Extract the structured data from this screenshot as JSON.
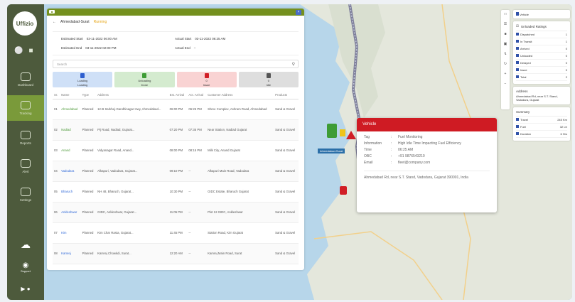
{
  "sidebar": {
    "logo": "Uffizio",
    "items": [
      {
        "label": "Dashboard",
        "icon": "gauge-icon"
      },
      {
        "label": "Tracking",
        "icon": "location-pin-icon",
        "active": true
      },
      {
        "label": "Reports",
        "icon": "report-icon"
      },
      {
        "label": "Alert",
        "icon": "bell-icon"
      },
      {
        "label": "Settings",
        "icon": "gear-icon"
      }
    ],
    "support": "Support"
  },
  "panel": {
    "breadcrumb": "Ahmedabad-Surat",
    "status": "Running",
    "dates": {
      "est_start_label": "Estimated Start",
      "est_start": "03-11-2022 06:00 AM",
      "est_end_label": "Estimated End",
      "est_end": "03-11-2022 02:00 PM",
      "actual_start_label": "Actual Start",
      "actual_start": "03-11-2022 06:25 AM",
      "actual_end_label": "Actual End",
      "actual_end": "--"
    },
    "search_placeholder": "Search",
    "cards": [
      {
        "label": "Loading",
        "sub": "Loading",
        "color": "#cfe0f7",
        "tk": "#2f5fcf"
      },
      {
        "label": "Unloading",
        "sub": "Done",
        "color": "#d4ebcf",
        "tk": "#3e9c35"
      },
      {
        "label": "0",
        "sub": "Issue",
        "color": "#f9d3d3",
        "tk": "#d11f26"
      },
      {
        "label": "0",
        "sub": "Idle",
        "color": "#dedede",
        "tk": "#555555"
      }
    ],
    "columns": [
      "Sr.",
      "Name",
      "Type",
      "Address",
      "Est. Arrival",
      "Act. Arrival",
      "Customer Address",
      "Products"
    ],
    "rows": [
      [
        "01",
        "Ahmedabad",
        "Planned",
        "12-B Sarkhej-Gandhinagar Hwy, Ahmedabad...",
        "06:00 PM",
        "06:25 PM",
        "Shree Complex, Ashram Road, Ahmedabad",
        "Sand & Gravel"
      ],
      [
        "02",
        "Nadiad",
        "Planned",
        "Pij Road, Nadiad, Gujarat...",
        "07:20 PM",
        "07:35 PM",
        "Near Station, Nadiad Gujarat",
        "Sand & Gravel"
      ],
      [
        "03",
        "Anand",
        "Planned",
        "Vidyanagar Road, Anand...",
        "08:00 PM",
        "08:15 PM",
        "Milk City, Anand Gujarat",
        "Sand & Gravel"
      ],
      [
        "04",
        "Vadodara",
        "Planned",
        "Alkapuri, Vadodara, Gujarat...",
        "09:10 PM",
        "--",
        "Alkapuri Main Road, Vadodara",
        "Sand & Gravel"
      ],
      [
        "05",
        "Bharuch",
        "Planned",
        "NH 48, Bharuch, Gujarat...",
        "10:30 PM",
        "--",
        "GIDC Estate, Bharuch Gujarat",
        "Sand & Gravel"
      ],
      [
        "06",
        "Ankleshwar",
        "Planned",
        "GIDC, Ankleshwar, Gujarat...",
        "11:05 PM",
        "--",
        "Plot 12 GIDC, Ankleshwar",
        "Sand & Gravel"
      ],
      [
        "07",
        "Kim",
        "Planned",
        "Kim Char Rasta, Gujarat...",
        "11:45 PM",
        "--",
        "Station Road, Kim Gujarat",
        "Sand & Gravel"
      ],
      [
        "08",
        "Kamrej",
        "Planned",
        "Kamrej Chowkdi, Surat...",
        "12:20 AM",
        "--",
        "Kamrej Main Road, Surat",
        "Sand & Gravel"
      ],
      [
        "09",
        "Surat",
        "Planned",
        "Ring Road, Surat, Gujarat...",
        "01:00 AM",
        "--",
        "Textile Market, Ring Road, Surat",
        "Sand & Gravel"
      ]
    ]
  },
  "popup": {
    "title": "Vehicle",
    "rows": [
      {
        "k": "Tag",
        "v": "Fuel Monitoring"
      },
      {
        "k": "Information",
        "v": "High Idle Time Impacting Fuel Efficiency"
      },
      {
        "k": "Time",
        "v": "06:25 AM"
      },
      {
        "k": "OBC",
        "v": "+91 9876543210"
      },
      {
        "k": "Email",
        "v": "fleet@company.com"
      }
    ],
    "address": "Ahmedabad Rd, near S.T. Stand, Vadodara, Gujarat 390001, India"
  },
  "marker_label": "Ahmedabad-Surat",
  "right_panel": {
    "toggle_label": "Vehicle",
    "title": "Unloaded Ratings",
    "rows": [
      {
        "k": "Dispatched",
        "v": "1"
      },
      {
        "k": "In Transit",
        "v": "1"
      },
      {
        "k": "Arrived",
        "v": "0"
      },
      {
        "k": "Unloaded",
        "v": "0"
      },
      {
        "k": "Delayed",
        "v": "0"
      },
      {
        "k": "Issue",
        "v": "0"
      },
      {
        "k": "Total",
        "v": "2"
      }
    ],
    "note_title": "Address",
    "note": "Ahmedabad Rd, near S.T. Stand, Vadodara, Gujarat",
    "summary_title": "Summary",
    "summary": [
      {
        "k": "Travel",
        "v": "245 Km"
      },
      {
        "k": "Fuel",
        "v": "32 Ltr"
      },
      {
        "k": "Duration",
        "v": "6 Hrs"
      }
    ]
  }
}
